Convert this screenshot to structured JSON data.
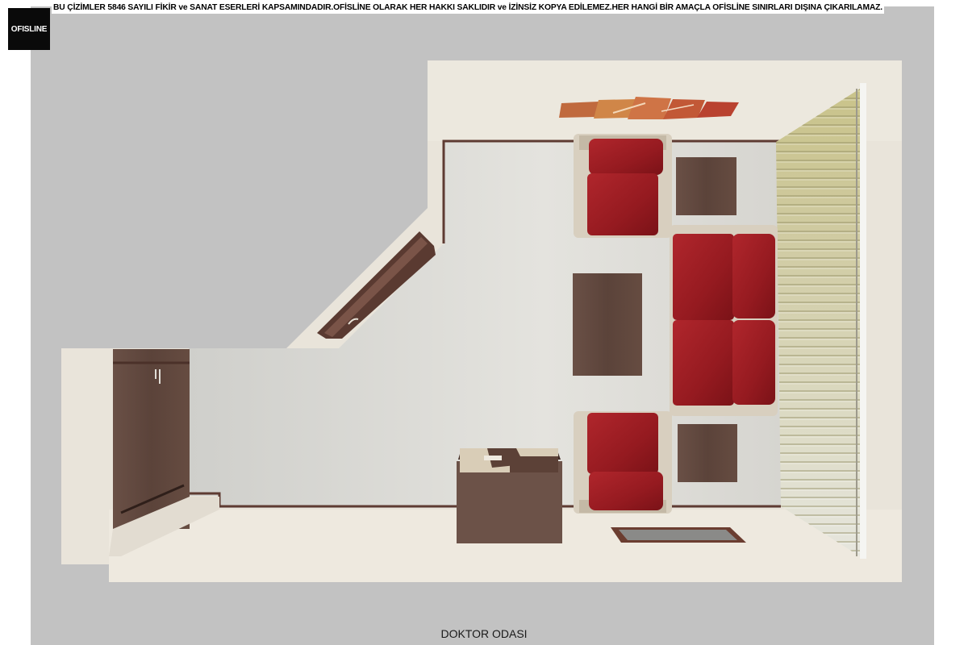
{
  "banner": {
    "text": "BU ÇİZİMLER 5846 SAYILI FİKİR ve SANAT ESERLERİ KAPSAMINDADIR.OFİSLİNE OLARAK HER HAKKI SAKLIDIR ve İZİNSİZ KOPYA EDİLEMEZ.HER HANGİ BİR AMAÇLA OFİSLİNE SINIRLARI DIŞINA ÇIKARILAMAZ."
  },
  "logo": {
    "text": "OFISLINE"
  },
  "caption": {
    "text": "DOKTOR ODASI"
  },
  "colors": {
    "background": "#c2c2c2",
    "floor": "#dcdbd6",
    "wall": "#e9e4da",
    "wood": "#5e463c",
    "leather": "#9c1d22",
    "sofa_frame": "#d8cfbf"
  }
}
